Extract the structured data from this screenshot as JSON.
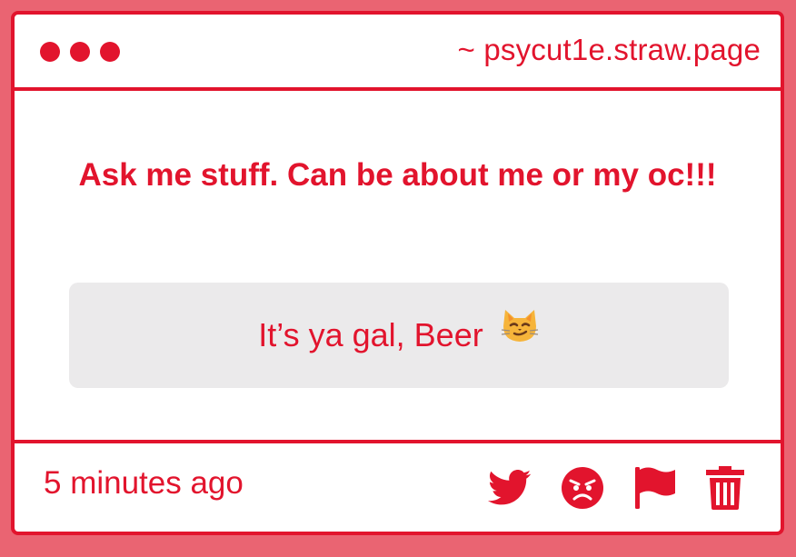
{
  "window": {
    "url": "~ psycut1e.straw.page"
  },
  "question": "Ask me stuff. Can be about me or my oc!!!",
  "answer": {
    "text": "It’s ya gal, Beer",
    "emoji": "smirking-cat-emoji"
  },
  "footer": {
    "timestamp": "5 minutes ago",
    "actions": [
      "twitter-icon",
      "angry-face-icon",
      "flag-icon",
      "trash-icon"
    ]
  },
  "colors": {
    "accent": "#e2142d",
    "background": "#ea6472",
    "card": "#ffffff",
    "answer_box": "#ebeaeb"
  }
}
